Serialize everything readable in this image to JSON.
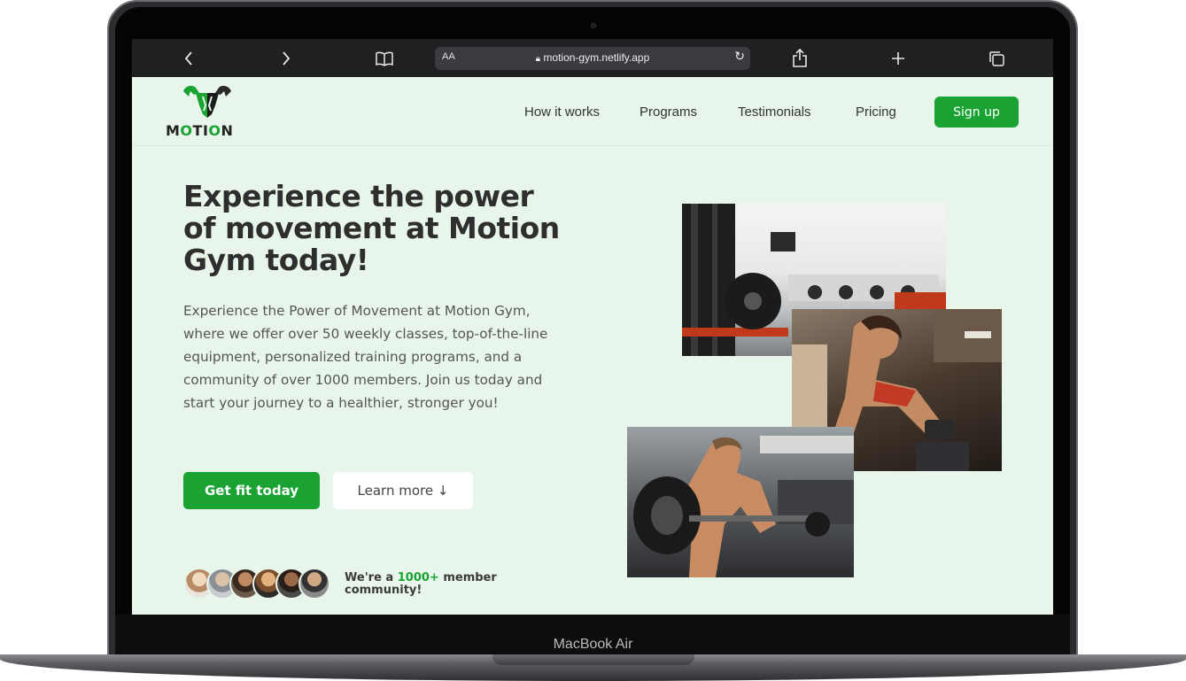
{
  "device": {
    "label": "MacBook Air"
  },
  "browser": {
    "text_size_label": "AA",
    "url": "motion-gym.netlify.app",
    "icons": [
      "back-icon",
      "forward-icon",
      "bookmarks-icon",
      "lock-icon",
      "reload-icon",
      "share-icon",
      "new-tab-icon",
      "tabs-icon"
    ]
  },
  "site": {
    "logo": {
      "word_prefix": "M",
      "word_o1": "O",
      "word_mid": "TI",
      "word_o2": "O",
      "word_suffix": "N"
    },
    "nav": {
      "how_it_works": "How it works",
      "programs": "Programs",
      "testimonials": "Testimonials",
      "pricing": "Pricing",
      "signup": "Sign up"
    },
    "hero": {
      "title": "Experience the power of movement at Motion Gym today!",
      "text": "Experience the Power of Movement at Motion Gym, where we offer over 50 weekly classes, top-of-the-line equipment, personalized training programs, and a community of over 1000 members. Join us today and start your journey to a healthier, stronger you!",
      "cta_primary": "Get fit today",
      "cta_secondary": "Learn more ↓",
      "community_prefix": "We're a ",
      "community_highlight": "1000+",
      "community_suffix": " member community!"
    },
    "colors": {
      "accent": "#1aa332",
      "background": "#e8f5ea",
      "heading": "#2e2e2e"
    }
  }
}
